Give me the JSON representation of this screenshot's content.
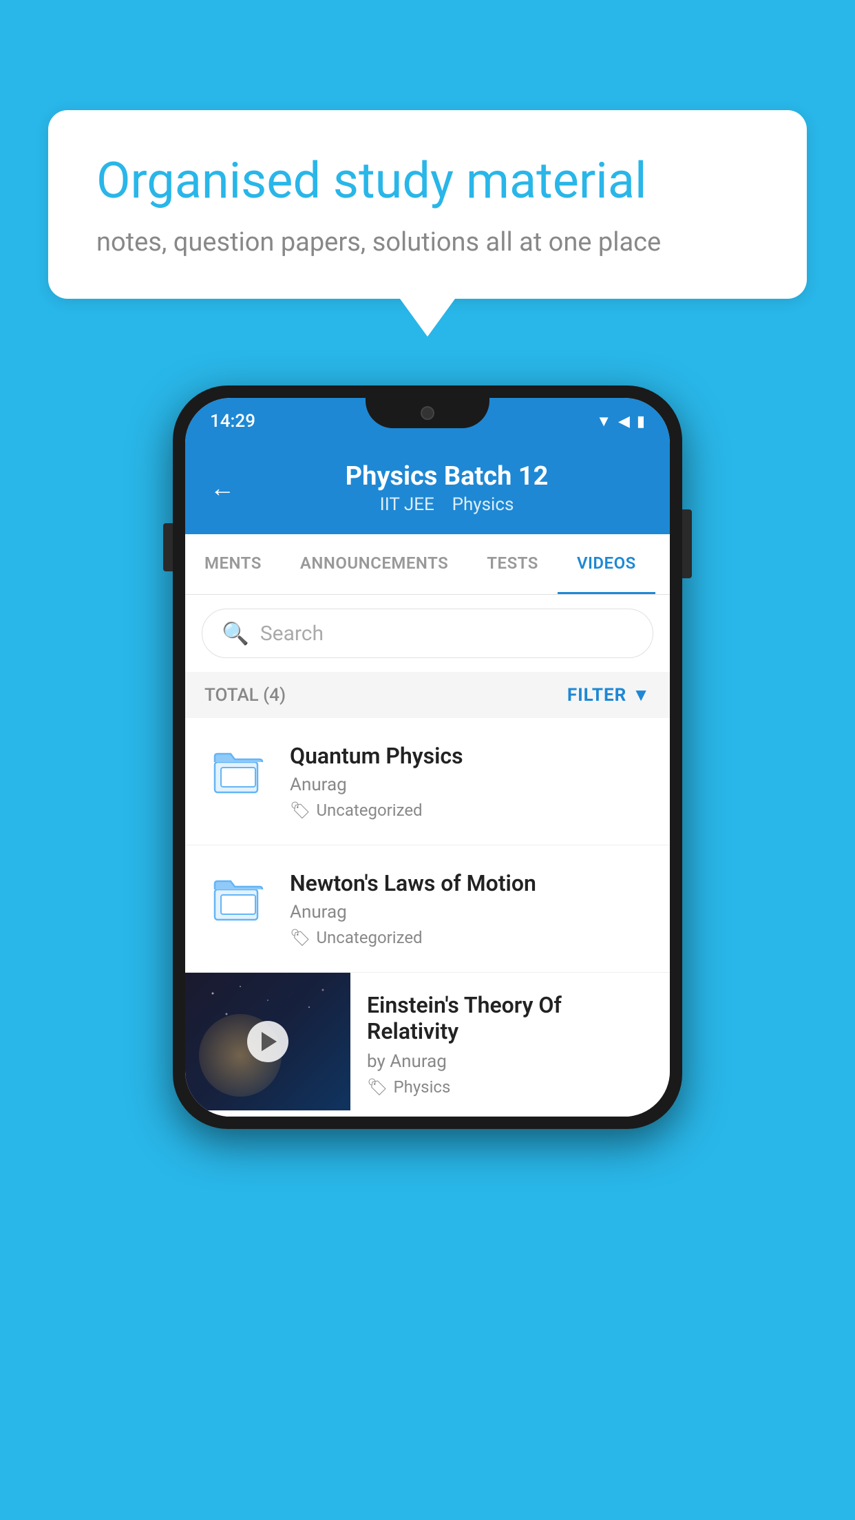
{
  "background_color": "#29b6e8",
  "speech_bubble": {
    "title": "Organised study material",
    "subtitle": "notes, question papers, solutions all at one place"
  },
  "phone": {
    "status_bar": {
      "time": "14:29",
      "wifi_icon": "wifi",
      "signal_icon": "signal",
      "battery_icon": "battery"
    },
    "header": {
      "back_label": "←",
      "title": "Physics Batch 12",
      "subtitle_part1": "IIT JEE",
      "subtitle_part2": "Physics"
    },
    "tabs": [
      {
        "label": "MENTS",
        "active": false
      },
      {
        "label": "ANNOUNCEMENTS",
        "active": false
      },
      {
        "label": "TESTS",
        "active": false
      },
      {
        "label": "VIDEOS",
        "active": true
      }
    ],
    "search": {
      "placeholder": "Search"
    },
    "filter_row": {
      "total_label": "TOTAL (4)",
      "filter_label": "FILTER"
    },
    "videos": [
      {
        "id": "v1",
        "title": "Quantum Physics",
        "author": "Anurag",
        "tag": "Uncategorized",
        "has_thumbnail": false
      },
      {
        "id": "v2",
        "title": "Newton's Laws of Motion",
        "author": "Anurag",
        "tag": "Uncategorized",
        "has_thumbnail": false
      },
      {
        "id": "v3",
        "title": "Einstein's Theory Of Relativity",
        "author": "by Anurag",
        "tag": "Physics",
        "has_thumbnail": true
      }
    ]
  }
}
